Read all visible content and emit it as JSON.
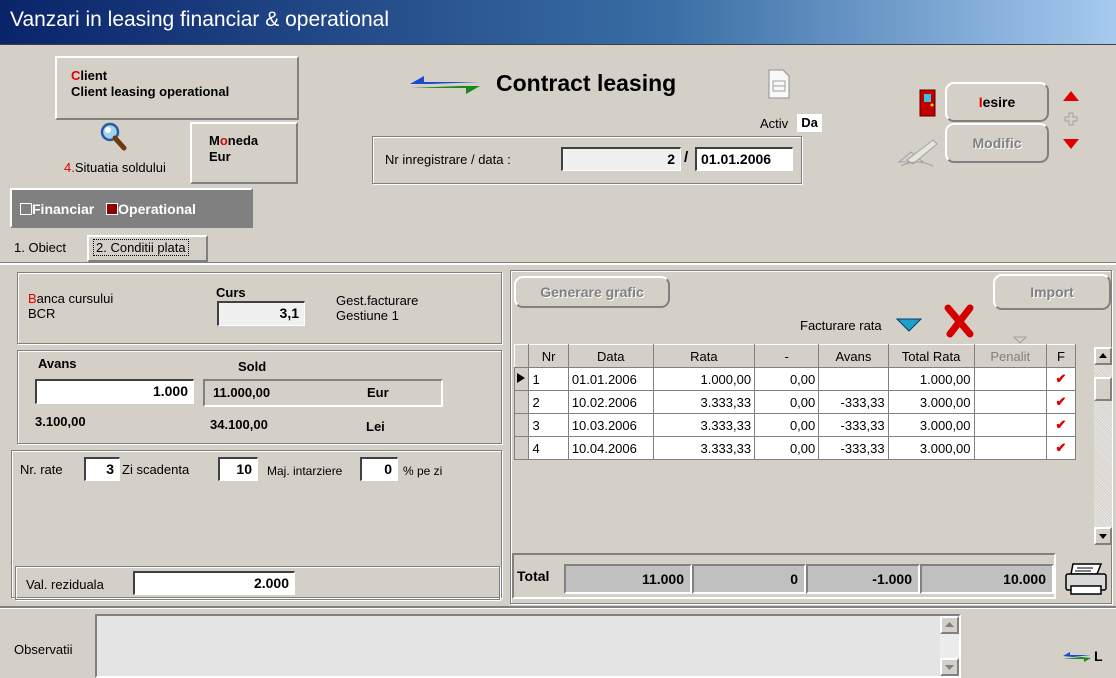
{
  "window": {
    "title": "Vanzari in leasing financiar & operational"
  },
  "client": {
    "label": "Client",
    "value": "Client leasing operational"
  },
  "moneda": {
    "label": "Moneda",
    "value": "Eur"
  },
  "situatia": {
    "label": "4.Situatia soldului"
  },
  "type_toggle": {
    "financiar": "Financiar",
    "operational": "Operational"
  },
  "header": {
    "title": "Contract leasing",
    "activ_label": "Activ",
    "activ_value": "Da",
    "nr_label": "Nr inregistrare / data :",
    "nr_value": "2",
    "separator": "/",
    "date_value": "01.01.2006"
  },
  "buttons": {
    "iesire": "Iesire",
    "modific": "Modific",
    "generare": "Generare grafic",
    "import": "Import"
  },
  "tabs": [
    {
      "label": "1. Obiect"
    },
    {
      "label": "2. Conditii plata"
    }
  ],
  "currency": {
    "banca_label": "Banca cursului",
    "banca_value": "BCR",
    "curs_label": "Curs",
    "curs_value": "3,1",
    "gest_label": "Gest.facturare",
    "gest_value": "Gestiune 1"
  },
  "avans": {
    "avans_label": "Avans",
    "sold_label": "Sold",
    "avans_eur": "1.000",
    "sold_eur": "11.000,00",
    "cur_eur": "Eur",
    "avans_lei": "3.100,00",
    "sold_lei": "34.100,00",
    "cur_lei": "Lei"
  },
  "rate": {
    "nr_label": "Nr. rate",
    "nr_value": "3",
    "zi_label": "Zi scadenta",
    "zi_value": "10",
    "maj_label": "Maj. intarziere",
    "maj_value": "0",
    "maj_unit": "% pe zi"
  },
  "reziduala": {
    "label": "Val. reziduala",
    "value": "2.000"
  },
  "facturare": {
    "label": "Facturare rata",
    "penalit_label": "Penalit"
  },
  "table": {
    "columns": [
      "Nr",
      "Data",
      "Rata",
      "-",
      "Avans",
      "Total Rata",
      "Penalit",
      "F"
    ],
    "rows": [
      {
        "nr": "1",
        "data": "01.01.2006",
        "rata": "1.000,00",
        "dash": "0,00",
        "avans": "",
        "total": "1.000,00",
        "penalit": "",
        "f": "✔"
      },
      {
        "nr": "2",
        "data": "10.02.2006",
        "rata": "3.333,33",
        "dash": "0,00",
        "avans": "-333,33",
        "total": "3.000,00",
        "penalit": "",
        "f": "✔"
      },
      {
        "nr": "3",
        "data": "10.03.2006",
        "rata": "3.333,33",
        "dash": "0,00",
        "avans": "-333,33",
        "total": "3.000,00",
        "penalit": "",
        "f": "✔"
      },
      {
        "nr": "4",
        "data": "10.04.2006",
        "rata": "3.333,33",
        "dash": "0,00",
        "avans": "-333,33",
        "total": "3.000,00",
        "penalit": "",
        "f": "✔"
      }
    ]
  },
  "totals": {
    "label": "Total",
    "rata": "11.000",
    "dash": "0",
    "avans": "-1.000",
    "total": "10.000"
  },
  "observatii": {
    "label": "Observatii"
  },
  "footer_logo": {
    "text": "L"
  }
}
